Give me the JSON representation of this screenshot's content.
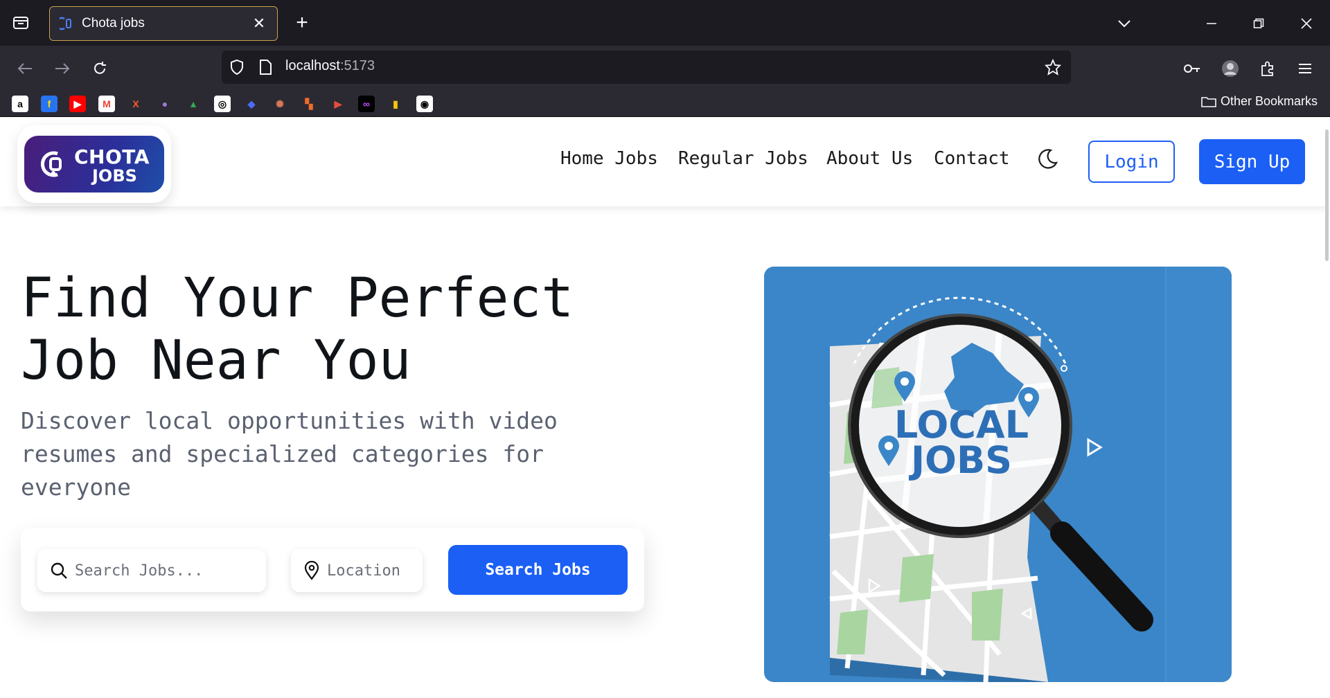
{
  "browser": {
    "tab_title": "Chota jobs",
    "url_host": "localhost",
    "url_port": ":5173",
    "other_bookmarks": "Other Bookmarks",
    "bookmarks": [
      {
        "name": "amazon",
        "glyph": "a",
        "color": "#ffffff",
        "fg": "#000000"
      },
      {
        "name": "flipkart",
        "glyph": "f",
        "color": "#2874f0",
        "fg": "#ffde00"
      },
      {
        "name": "youtube",
        "glyph": "▶",
        "color": "#ff0000",
        "fg": "#ffffff"
      },
      {
        "name": "gmail",
        "glyph": "M",
        "color": "#ffffff",
        "fg": "#ea4335"
      },
      {
        "name": "x",
        "glyph": "X",
        "color": "#2b2a33",
        "fg": "#ff5a2a"
      },
      {
        "name": "orb",
        "glyph": "●",
        "color": "#2b2a33",
        "fg": "#a07bd6"
      },
      {
        "name": "google-drive",
        "glyph": "▲",
        "color": "#2b2a33",
        "fg": "#34a853"
      },
      {
        "name": "chatgpt",
        "glyph": "◎",
        "color": "#ffffff",
        "fg": "#000000"
      },
      {
        "name": "deepseek",
        "glyph": "◆",
        "color": "#2b2a33",
        "fg": "#4d6bfe"
      },
      {
        "name": "claude",
        "glyph": "✺",
        "color": "#2b2a33",
        "fg": "#d97757"
      },
      {
        "name": "pinwheel",
        "glyph": "▚",
        "color": "#2b2a33",
        "fg": "#f06a2a"
      },
      {
        "name": "flag",
        "glyph": "▶",
        "color": "#2b2a33",
        "fg": "#e74c3c"
      },
      {
        "name": "infinity",
        "glyph": "∞",
        "color": "#000000",
        "fg": "#c84dff"
      },
      {
        "name": "bars",
        "glyph": "▮",
        "color": "#2b2a33",
        "fg": "#f1c40f"
      },
      {
        "name": "github",
        "glyph": "◉",
        "color": "#ffffff",
        "fg": "#000000"
      }
    ]
  },
  "header": {
    "logo_line1": "CHOTA",
    "logo_line2": "JOBS",
    "nav": [
      "Home Jobs",
      "Regular Jobs",
      "About Us",
      "Contact"
    ],
    "login": "Login",
    "signup": "Sign Up"
  },
  "hero": {
    "title_line1": "Find Your Perfect",
    "title_line2": "Job Near You",
    "subtitle": "Discover local opportunities with video resumes and specialized categories for everyone",
    "search_placeholder": "Search Jobs...",
    "location_placeholder": "Location",
    "search_button": "Search Jobs",
    "image_text_line1": "LOCAL",
    "image_text_line2": "JOBS"
  },
  "colors": {
    "primary": "#1b5ff5",
    "hero_image_bg": "#3a86c8",
    "title": "#101418",
    "subtitle": "#5a6170"
  }
}
